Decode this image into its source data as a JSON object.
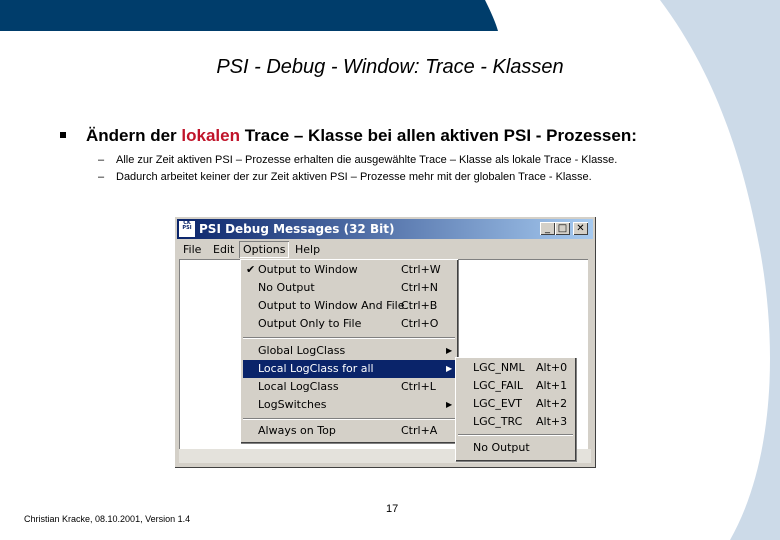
{
  "slide": {
    "title": "PSI - Debug - Window:  Trace - Klassen",
    "bullet": {
      "before": "Ändern der ",
      "highlight": "lokalen",
      "after": " Trace – Klasse bei allen aktiven PSI - Prozessen:"
    },
    "sub_bullets": [
      "Alle zur Zeit aktiven PSI – Prozesse erhalten die ausgewählte Trace – Klasse als lokale Trace - Klasse.",
      "Dadurch arbeitet keiner der zur Zeit aktiven PSI – Prozesse mehr mit der globalen Trace - Klasse."
    ],
    "dash": "–",
    "footer": "Christian Kracke, 08.10.2001, Version 1.4",
    "page_number": "17"
  },
  "window": {
    "title": "PSI Debug Messages (32 Bit)",
    "icon_text": "CK PSI",
    "buttons": {
      "minimize": "_",
      "maximize": "□",
      "close": "✕"
    },
    "menubar": [
      "File",
      "Edit",
      "Options",
      "Help"
    ]
  },
  "options_menu": {
    "items": [
      {
        "label": "Output to Window",
        "shortcut": "Ctrl+W",
        "checked": true
      },
      {
        "label": "No Output",
        "shortcut": "Ctrl+N"
      },
      {
        "label": "Output to Window And File",
        "shortcut": "Ctrl+B"
      },
      {
        "label": "Output Only to File",
        "shortcut": "Ctrl+O"
      },
      {
        "label": "Global LogClass",
        "submenu": true
      },
      {
        "label": "Local LogClass for all",
        "submenu": true,
        "highlighted": true
      },
      {
        "label": "Local LogClass",
        "shortcut": "Ctrl+L"
      },
      {
        "label": "LogSwitches",
        "submenu": true
      },
      {
        "label": "Always on Top",
        "shortcut": "Ctrl+A"
      }
    ],
    "check_mark": "✔",
    "submenu_arrow": "▶"
  },
  "logclass_submenu": {
    "items": [
      {
        "label": "LGC_NML",
        "shortcut": "Alt+0"
      },
      {
        "label": "LGC_FAIL",
        "shortcut": "Alt+1"
      },
      {
        "label": "LGC_EVT",
        "shortcut": "Alt+2"
      },
      {
        "label": "LGC_TRC",
        "shortcut": "Alt+3"
      },
      {
        "label": "No Output",
        "shortcut": ""
      }
    ]
  },
  "colors": {
    "header_band": "#003d6b",
    "side_band": "#ccdae8",
    "highlight_text": "#c0142a",
    "menu_highlight": "#0a246a"
  }
}
